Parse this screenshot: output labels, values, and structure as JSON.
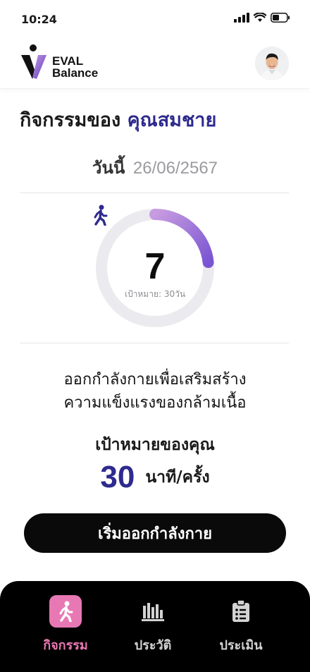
{
  "status_bar": {
    "time": "10:24"
  },
  "header": {
    "logo_line1": "EVAL",
    "logo_line2": "Balance"
  },
  "title": {
    "prefix": "กิจกรรมของ",
    "name": "คุณสมชาย"
  },
  "today": {
    "label": "วันนี้",
    "date": "26/06/2567"
  },
  "progress": {
    "count": "7",
    "target_text": "เป้าหมาย: 30วัน",
    "fraction": 0.2333
  },
  "description": {
    "line1": "ออกกำลังกายเพื่อเสริมสร้าง",
    "line2": "ความแข็งแรงของกล้ามเนื้อ"
  },
  "goal": {
    "label": "เป้าหมายของคุณ",
    "value": "30",
    "unit": "นาที/ครั้ง"
  },
  "start_button": {
    "label": "เริ่มออกกำลังกาย"
  },
  "nav": {
    "items": [
      {
        "label": "กิจกรรม",
        "icon": "walk-icon",
        "active": true
      },
      {
        "label": "ประวัติ",
        "icon": "bar-chart-icon",
        "active": false
      },
      {
        "label": "ประเมิน",
        "icon": "clipboard-icon",
        "active": false
      }
    ]
  },
  "colors": {
    "accent": "#2e2a8e",
    "nav_active": "#e878b4",
    "ring_start": "#c79be0",
    "ring_end": "#7a55d3",
    "ring_track": "#ebebef"
  }
}
